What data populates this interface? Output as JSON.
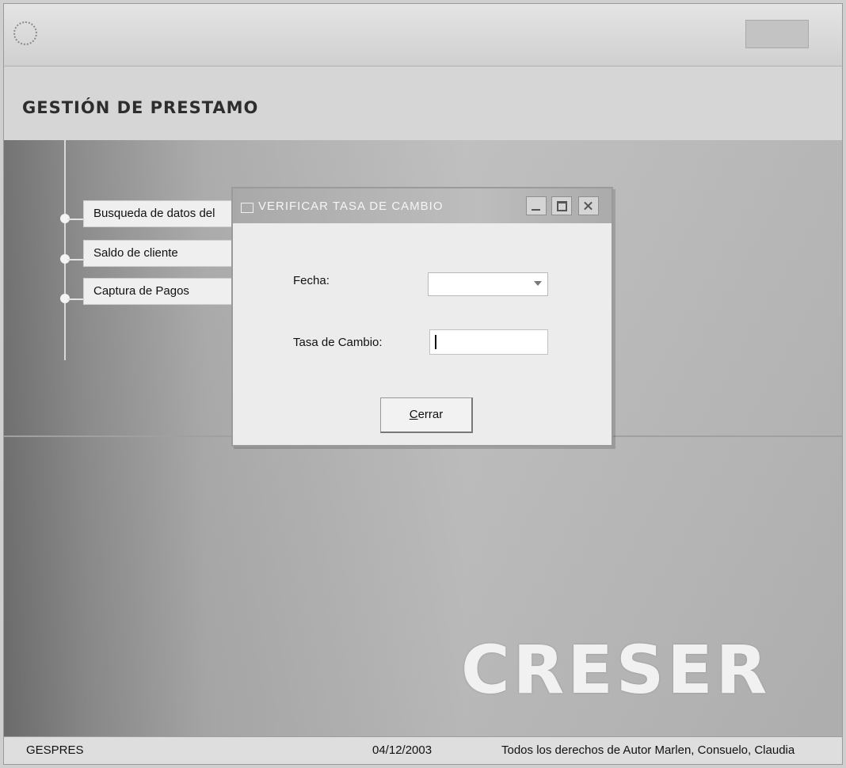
{
  "window": {
    "title": ""
  },
  "app": {
    "title": "GESTIÓN DE PRESTAMO",
    "watermark": "CRESER"
  },
  "menu": {
    "items": [
      {
        "label": "Busqueda de datos del"
      },
      {
        "label": "Saldo de cliente"
      },
      {
        "label": "Captura de Pagos"
      }
    ]
  },
  "dialog": {
    "title": "VERIFICAR TASA DE CAMBIO",
    "fecha_label": "Fecha:",
    "fecha_value": "",
    "tasa_label": "Tasa de Cambio:",
    "tasa_value": "",
    "close_button_accel": "C",
    "close_button_rest": "errar"
  },
  "statusbar": {
    "left": "GESPRES",
    "date": "04/12/2003",
    "copyright": "Todos los derechos de Autor Marlen, Consuelo, Claudia"
  },
  "icons": {
    "app": "app-icon",
    "dialog": "window-icon",
    "dropdown": "chevron-down-icon",
    "minimize": "minimize-icon",
    "maximize": "maximize-icon",
    "close": "close-icon"
  },
  "colors": {
    "background": "#d7d7d7",
    "dialog": "#ececec",
    "accent": "#a9a9a9"
  }
}
